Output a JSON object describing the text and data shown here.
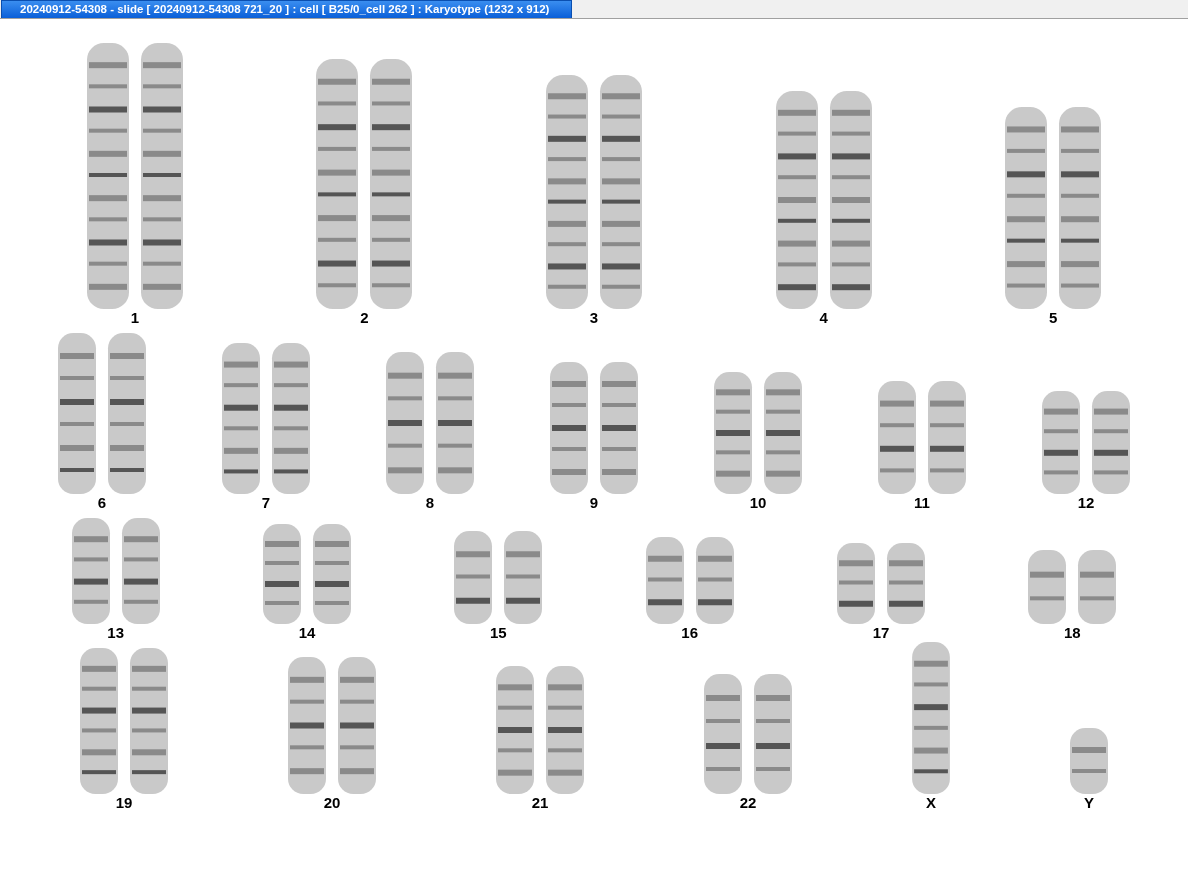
{
  "window": {
    "title": "20240912-54308 - slide [ 20240912-54308 721_20 ] : cell [ B25/0_cell 262 ] : Karyotype  (1232 x 912)"
  },
  "karyotype_rows": [
    {
      "chromosomes": [
        {
          "label": "1",
          "kind": "pair"
        },
        {
          "label": "2",
          "kind": "pair"
        },
        {
          "label": "3",
          "kind": "pair"
        },
        {
          "label": "4",
          "kind": "pair"
        },
        {
          "label": "5",
          "kind": "pair"
        }
      ]
    },
    {
      "chromosomes": [
        {
          "label": "6",
          "kind": "pair"
        },
        {
          "label": "7",
          "kind": "pair"
        },
        {
          "label": "8",
          "kind": "pair"
        },
        {
          "label": "9",
          "kind": "pair"
        },
        {
          "label": "10",
          "kind": "pair"
        },
        {
          "label": "11",
          "kind": "pair"
        },
        {
          "label": "12",
          "kind": "pair"
        }
      ]
    },
    {
      "chromosomes": [
        {
          "label": "13",
          "kind": "pair"
        },
        {
          "label": "14",
          "kind": "pair"
        },
        {
          "label": "15",
          "kind": "pair"
        },
        {
          "label": "16",
          "kind": "pair"
        },
        {
          "label": "17",
          "kind": "pair"
        },
        {
          "label": "18",
          "kind": "pair"
        }
      ]
    },
    {
      "chromosomes": [
        {
          "label": "19",
          "kind": "pair"
        },
        {
          "label": "20",
          "kind": "pair"
        },
        {
          "label": "21",
          "kind": "pair"
        },
        {
          "label": "22",
          "kind": "pair"
        },
        {
          "label": "X",
          "kind": "single"
        },
        {
          "label": "Y",
          "kind": "single"
        }
      ]
    }
  ]
}
